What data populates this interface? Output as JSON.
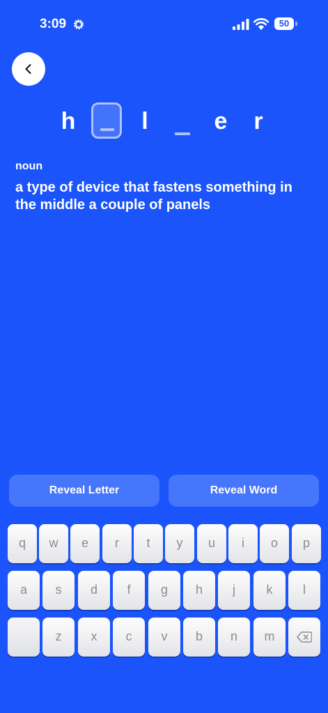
{
  "status": {
    "time": "3:09",
    "battery": "50"
  },
  "word": {
    "letters": [
      "h",
      "l",
      "e",
      "r"
    ]
  },
  "entry": {
    "part_of_speech": "noun",
    "definition": "a type of device that fastens something in the middle a couple of panels"
  },
  "actions": {
    "reveal_letter": "Reveal Letter",
    "reveal_word": "Reveal Word"
  },
  "keyboard": {
    "row1": [
      "q",
      "w",
      "e",
      "r",
      "t",
      "y",
      "u",
      "i",
      "o",
      "p"
    ],
    "row2": [
      "a",
      "s",
      "d",
      "f",
      "g",
      "h",
      "j",
      "k",
      "l"
    ],
    "row3": [
      "z",
      "x",
      "c",
      "v",
      "b",
      "n",
      "m"
    ]
  },
  "colors": {
    "background": "#1a54fa",
    "button": "#4576fc",
    "slot": "#aec3fb"
  },
  "icons": [
    "gear-icon",
    "signal-icon",
    "wifi-icon",
    "battery-icon",
    "chevron-left-icon",
    "backspace-icon"
  ]
}
